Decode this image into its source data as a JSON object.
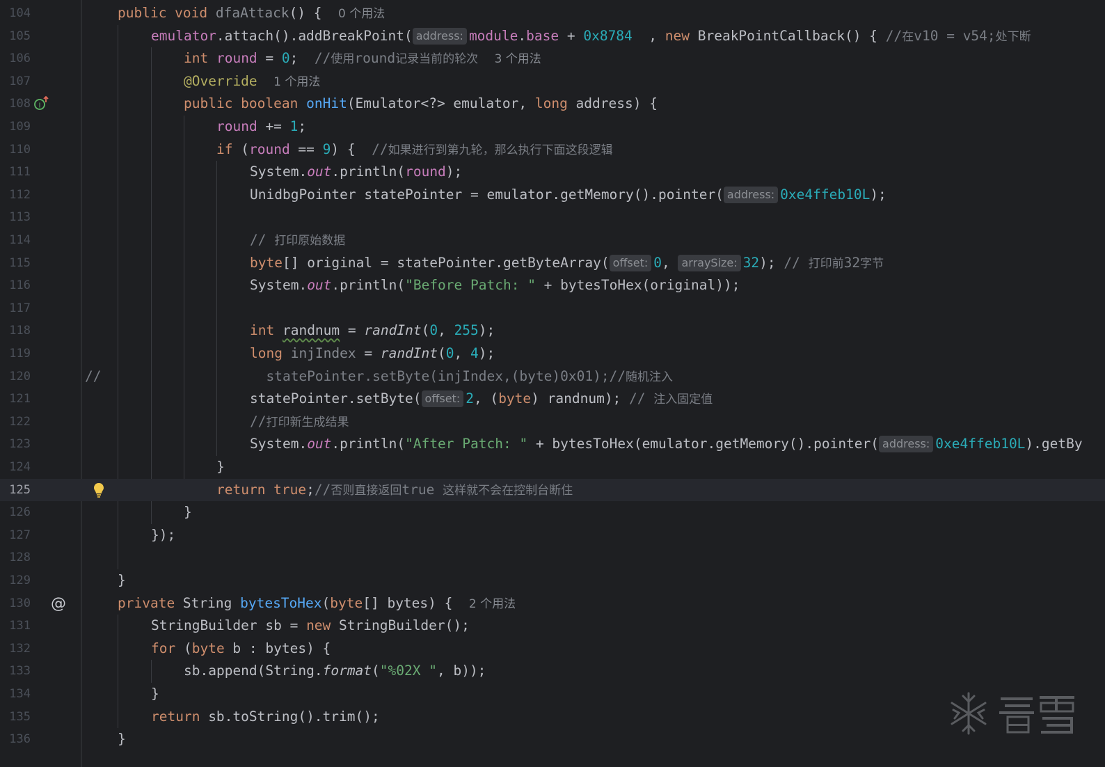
{
  "editor": {
    "current_line": 125,
    "colors": {
      "background": "#1e1f22",
      "keyword": "#cf8e6d",
      "function": "#56a8f5",
      "number": "#2aacb8",
      "string": "#6aab73",
      "comment": "#7a7e85",
      "annotation": "#b3ae60",
      "field": "#c77dbb"
    },
    "lines": [
      {
        "n": "104",
        "t": [
          [
            "kw",
            "public void "
          ],
          [
            "unused",
            "dfaAttack"
          ],
          [
            "",
            "() {  "
          ],
          [
            "usage",
            "0 个用法"
          ]
        ]
      },
      {
        "n": "105",
        "t": [
          [
            "fld",
            "emulator"
          ],
          [
            "",
            ".attach().addBreakPoint("
          ],
          [
            "hint",
            "address:"
          ],
          [
            "fld",
            "module"
          ],
          [
            "",
            "."
          ],
          [
            "fld",
            "base"
          ],
          [
            "",
            " + "
          ],
          [
            "num",
            "0x8784"
          ],
          [
            "",
            "  , "
          ],
          [
            "kw",
            "new "
          ],
          [
            "",
            "BreakPointCallback() { "
          ],
          [
            "cmt",
            "//"
          ],
          [
            "cmt cjk",
            "在"
          ],
          [
            "cmt",
            "v10 = v54;"
          ],
          [
            "cmt cjk",
            "处下断"
          ]
        ]
      },
      {
        "n": "106",
        "t": [
          [
            "kw",
            "int "
          ],
          [
            "fld",
            "round"
          ],
          [
            "",
            " = "
          ],
          [
            "num",
            "0"
          ],
          [
            "",
            ";  "
          ],
          [
            "cmt",
            "//"
          ],
          [
            "cmt cjk",
            "使用"
          ],
          [
            "cmt",
            "round"
          ],
          [
            "cmt cjk",
            "记录当前的轮次"
          ],
          [
            "",
            "  "
          ],
          [
            "usage",
            "3 个用法"
          ]
        ]
      },
      {
        "n": "107",
        "t": [
          [
            "ann",
            "@Override"
          ],
          [
            "",
            "  "
          ],
          [
            "usage",
            "1 个用法"
          ]
        ]
      },
      {
        "n": "108",
        "t": [
          [
            "kw",
            "public boolean "
          ],
          [
            "fn",
            "onHit"
          ],
          [
            "",
            "(Emulator<?> emulator, "
          ],
          [
            "kw",
            "long "
          ],
          [
            "",
            "address) {"
          ]
        ]
      },
      {
        "n": "109",
        "t": [
          [
            "fld",
            "round"
          ],
          [
            "",
            " += "
          ],
          [
            "num",
            "1"
          ],
          [
            "",
            ";"
          ]
        ]
      },
      {
        "n": "110",
        "t": [
          [
            "kw",
            "if "
          ],
          [
            "",
            "("
          ],
          [
            "fld",
            "round"
          ],
          [
            "",
            " == "
          ],
          [
            "num",
            "9"
          ],
          [
            "",
            ") {  "
          ],
          [
            "cmt",
            "//"
          ],
          [
            "cmt cjk",
            "如果进行到第九轮，那么执行下面这段逻辑"
          ]
        ]
      },
      {
        "n": "111",
        "t": [
          [
            "",
            "System."
          ],
          [
            "st",
            "out"
          ],
          [
            "",
            ".println("
          ],
          [
            "fld",
            "round"
          ],
          [
            "",
            ");"
          ]
        ]
      },
      {
        "n": "112",
        "t": [
          [
            "",
            "UnidbgPointer statePointer = emulator.getMemory().pointer("
          ],
          [
            "hint",
            "address:"
          ],
          [
            "num",
            "0xe4ffeb10L"
          ],
          [
            "",
            ");"
          ]
        ]
      },
      {
        "n": "113",
        "t": []
      },
      {
        "n": "114",
        "t": [
          [
            "cmt",
            "// "
          ],
          [
            "cmt cjk",
            "打印原始数据"
          ]
        ]
      },
      {
        "n": "115",
        "t": [
          [
            "kw",
            "byte"
          ],
          [
            "",
            "[] original = statePointer.getByteArray("
          ],
          [
            "hint",
            "offset:"
          ],
          [
            "num",
            "0"
          ],
          [
            "",
            ", "
          ],
          [
            "hint",
            "arraySize:"
          ],
          [
            "num",
            "32"
          ],
          [
            "",
            "); "
          ],
          [
            "cmt",
            "// "
          ],
          [
            "cmt cjk",
            "打印前"
          ],
          [
            "cmt",
            "32"
          ],
          [
            "cmt cjk",
            "字节"
          ]
        ]
      },
      {
        "n": "116",
        "t": [
          [
            "",
            "System."
          ],
          [
            "st",
            "out"
          ],
          [
            "",
            ".println("
          ],
          [
            "str",
            "\"Before Patch: \""
          ],
          [
            "",
            " + bytesToHex(original));"
          ]
        ]
      },
      {
        "n": "117",
        "t": []
      },
      {
        "n": "118",
        "t": [
          [
            "kw",
            "int "
          ],
          [
            "wavy",
            "randnum"
          ],
          [
            "",
            " = "
          ],
          [
            "it",
            "randInt"
          ],
          [
            "",
            "("
          ],
          [
            "num",
            "0"
          ],
          [
            "",
            ", "
          ],
          [
            "num",
            "255"
          ],
          [
            "",
            ");"
          ]
        ]
      },
      {
        "n": "119",
        "t": [
          [
            "kw",
            "long "
          ],
          [
            "unused",
            "injIndex"
          ],
          [
            "",
            " = "
          ],
          [
            "it",
            "randInt"
          ],
          [
            "",
            "("
          ],
          [
            "num",
            "0"
          ],
          [
            "",
            ", "
          ],
          [
            "num",
            "4"
          ],
          [
            "",
            ");"
          ]
        ]
      },
      {
        "n": "120",
        "t": [
          [
            "cmt",
            "  statePointer.setByte(injIndex,(byte)0x01);//"
          ],
          [
            "cmt cjk",
            "随机注入"
          ]
        ]
      },
      {
        "n": "121",
        "t": [
          [
            "",
            "statePointer.setByte("
          ],
          [
            "hint",
            "offset:"
          ],
          [
            "num",
            "2"
          ],
          [
            "",
            ", ("
          ],
          [
            "kw",
            "byte"
          ],
          [
            "",
            ") randnum); "
          ],
          [
            "cmt",
            "// "
          ],
          [
            "cmt cjk",
            "注入固定值"
          ]
        ]
      },
      {
        "n": "122",
        "t": [
          [
            "cmt",
            "//"
          ],
          [
            "cmt cjk",
            "打印新生成结果"
          ]
        ]
      },
      {
        "n": "123",
        "t": [
          [
            "",
            "System."
          ],
          [
            "st",
            "out"
          ],
          [
            "",
            ".println("
          ],
          [
            "str",
            "\"After Patch: \""
          ],
          [
            "",
            " + bytesToHex(emulator.getMemory().pointer("
          ],
          [
            "hint",
            "address:"
          ],
          [
            "num",
            "0xe4ffeb10L"
          ],
          [
            "",
            ").getBy"
          ]
        ]
      },
      {
        "n": "124",
        "t": [
          [
            "",
            "}"
          ]
        ]
      },
      {
        "n": "125",
        "t": [
          [
            "kw",
            "return true"
          ],
          [
            "",
            ";"
          ],
          [
            "cmt",
            "//"
          ],
          [
            "cmt cjk",
            "否则直接返回"
          ],
          [
            "cmt",
            "true "
          ],
          [
            "cmt cjk",
            "这样就不会在控制台断住"
          ]
        ]
      },
      {
        "n": "126",
        "t": [
          [
            "",
            "}"
          ]
        ]
      },
      {
        "n": "127",
        "t": [
          [
            "",
            "});"
          ]
        ]
      },
      {
        "n": "128",
        "t": []
      },
      {
        "n": "129",
        "t": [
          [
            "",
            "}"
          ]
        ]
      },
      {
        "n": "130",
        "t": [
          [
            "kw",
            "private "
          ],
          [
            "",
            "String "
          ],
          [
            "fn",
            "bytesToHex"
          ],
          [
            "",
            "("
          ],
          [
            "kw",
            "byte"
          ],
          [
            "",
            "[] bytes) {  "
          ],
          [
            "usage",
            "2 个用法"
          ]
        ]
      },
      {
        "n": "131",
        "t": [
          [
            "",
            "StringBuilder sb = "
          ],
          [
            "kw",
            "new "
          ],
          [
            "",
            "StringBuilder();"
          ]
        ]
      },
      {
        "n": "132",
        "t": [
          [
            "kw",
            "for "
          ],
          [
            "",
            "("
          ],
          [
            "kw",
            "byte "
          ],
          [
            "",
            "b : bytes) {"
          ]
        ]
      },
      {
        "n": "133",
        "t": [
          [
            "",
            "sb.append(String."
          ],
          [
            "it",
            "format"
          ],
          [
            "",
            "("
          ],
          [
            "str",
            "\"%02X \""
          ],
          [
            "",
            ", b));"
          ]
        ]
      },
      {
        "n": "134",
        "t": [
          [
            "",
            "}"
          ]
        ]
      },
      {
        "n": "135",
        "t": [
          [
            "kw",
            "return "
          ],
          [
            "",
            "sb.toString().trim();"
          ]
        ]
      },
      {
        "n": "136",
        "t": [
          [
            "",
            "}"
          ]
        ]
      }
    ],
    "line_comment_prefix": {
      "line": "120",
      "text": "//"
    },
    "gutter_icons": [
      {
        "line": "108",
        "name": "override-method-icon"
      },
      {
        "line": "125",
        "name": "lightbulb-icon"
      },
      {
        "line": "130",
        "name": "annotation-at-icon"
      }
    ]
  }
}
